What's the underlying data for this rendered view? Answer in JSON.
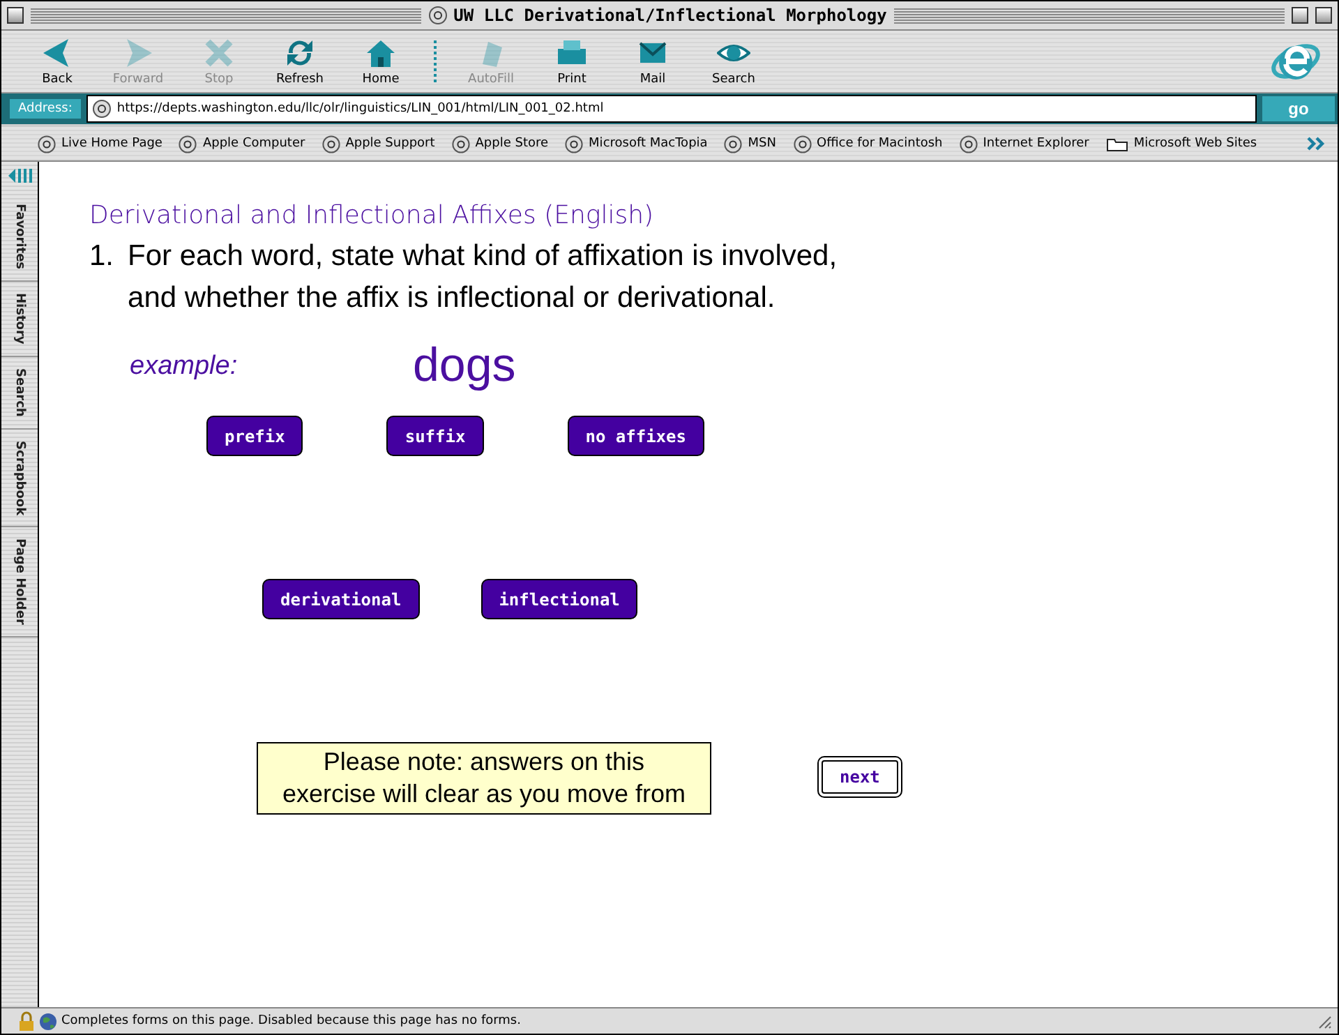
{
  "window": {
    "title": "UW LLC Derivational/Inflectional Morphology"
  },
  "toolbar": {
    "buttons": [
      {
        "label": "Back",
        "kind": "back",
        "disabled": false
      },
      {
        "label": "Forward",
        "kind": "forward",
        "disabled": true
      },
      {
        "label": "Stop",
        "kind": "stop",
        "disabled": true
      },
      {
        "label": "Refresh",
        "kind": "refresh",
        "disabled": false
      },
      {
        "label": "Home",
        "kind": "home",
        "disabled": false
      },
      {
        "label": "AutoFill",
        "kind": "autofill",
        "disabled": true
      },
      {
        "label": "Print",
        "kind": "print",
        "disabled": false
      },
      {
        "label": "Mail",
        "kind": "mail",
        "disabled": false
      },
      {
        "label": "Search",
        "kind": "search",
        "disabled": false
      }
    ]
  },
  "address": {
    "label": "Address:",
    "value": "https://depts.washington.edu/llc/olr/linguistics/LIN_001/html/LIN_001_02.html",
    "go": "go"
  },
  "favorites": [
    {
      "label": "Live Home Page",
      "kind": "page"
    },
    {
      "label": "Apple Computer",
      "kind": "page"
    },
    {
      "label": "Apple Support",
      "kind": "page"
    },
    {
      "label": "Apple Store",
      "kind": "page"
    },
    {
      "label": "Microsoft MacTopia",
      "kind": "page"
    },
    {
      "label": "MSN",
      "kind": "page"
    },
    {
      "label": "Office for Macintosh",
      "kind": "page"
    },
    {
      "label": "Internet Explorer",
      "kind": "page"
    },
    {
      "label": "Microsoft Web Sites",
      "kind": "folder"
    }
  ],
  "sidebar": {
    "tabs": [
      "Favorites",
      "History",
      "Search",
      "Scrapbook",
      "Page Holder"
    ]
  },
  "page": {
    "heading": "Derivational and Inflectional Affixes (English)",
    "question_number": "1.",
    "question": "For each word, state what kind of affixation is involved, and whether the affix is inflectional or derivational.",
    "example_label": "example:",
    "example_word": "dogs",
    "affix_buttons": [
      "prefix",
      "suffix",
      "no affixes"
    ],
    "type_buttons": [
      "derivational",
      "inflectional"
    ],
    "note": "Please note: answers on this exercise will clear as you move from",
    "next": "next"
  },
  "status_bar": "Completes forms on this page.  Disabled because this page has no forms."
}
